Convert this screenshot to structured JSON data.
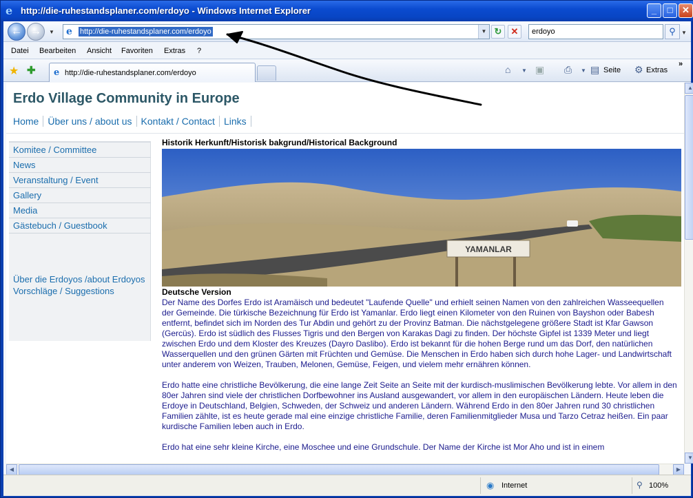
{
  "window": {
    "title": "http://die-ruhestandsplaner.com/erdoyo - Windows Internet Explorer",
    "buttons": {
      "minimize": "_",
      "maximize": "□",
      "close": "✕"
    }
  },
  "addressbar": {
    "back_icon": "back-arrow-icon",
    "forward_icon": "forward-arrow-icon",
    "url": "http://die-ruhestandsplaner.com/erdoyo",
    "search_value": "erdoyo"
  },
  "menubar": {
    "items": [
      "Datei",
      "Bearbeiten",
      "Ansicht",
      "Favoriten",
      "Extras",
      "?"
    ]
  },
  "tabbar": {
    "tab_label": "http://die-ruhestandsplaner.com/erdoyo",
    "commands": {
      "page": "Seite",
      "tools": "Extras"
    }
  },
  "page": {
    "site_title": "Erdo Village Community in Europe",
    "topnav": [
      "Home",
      "Über uns / about us",
      "Kontakt / Contact",
      "Links"
    ],
    "sidenav": [
      "Komitee / Committee",
      "News",
      "Veranstaltung / Event",
      "Gallery",
      "Media",
      "Gästebuch / Guestbook"
    ],
    "side_links": [
      "Über die Erdoyos /about Erdoyos",
      "Vorschläge / Suggestions"
    ],
    "section_heading": "Historik Herkunft/Historisk bakgrund/Historical Background",
    "photo_sign": "YAMANLAR",
    "version_heading": "Deutsche Version",
    "paragraphs": [
      "Der Name des Dorfes Erdo ist Aramäisch und bedeutet \"Laufende Quelle\" und erhielt seinen Namen von den zahlreichen Wasseequellen der Gemeinde. Die türkische Bezeichnung für Erdo ist Yamanlar. Erdo liegt einen Kilometer von den Ruinen von Bayshon oder Babesh entfernt, befindet sich im Norden des Tur Abdin und gehört zu der Provinz Batman. Die nächstgelegene größere Stadt ist Kfar Gawson (Gercüs). Erdo ist südlich des Flusses Tigris und den Bergen von Karakas Dagi zu finden. Der höchste Gipfel ist 1339 Meter und liegt zwischen Erdo und dem Kloster des Kreuzes (Dayro Daslibo). Erdo ist bekannt für die hohen Berge rund um das Dorf, den natürlichen Wasserquellen und den grünen Gärten mit Früchten und Gemüse. Die Menschen in Erdo haben sich durch hohe Lager- und Landwirtschaft unter anderem von Weizen, Trauben, Melonen, Gemüse, Feigen, und vielem mehr ernähren können.",
      "Erdo hatte eine christliche Bevölkerung, die eine lange Zeit Seite an Seite mit der kurdisch-muslimischen Bevölkerung lebte. Vor allem in den 80er Jahren sind viele der christlichen Dorfbewohner ins Ausland ausgewandert, vor allem in den europäischen Ländern. Heute leben die Erdoye in Deutschland, Belgien, Schweden, der Schweiz und anderen Ländern. Während Erdo in den 80er Jahren rund 30 christlichen Familien zählte, ist es heute gerade mal eine einzige christliche Familie, deren Familienmitglieder Musa und Tarzo Cetraz heißen. Ein paar kurdische Familien leben auch in Erdo.",
      "Erdo hat eine sehr kleine Kirche, eine Moschee und eine Grundschule. Der Name der Kirche ist Mor Aho und ist in einem"
    ]
  },
  "statusbar": {
    "zone": "Internet",
    "zoom": "100%"
  },
  "colors": {
    "title_bar": "#0b4bd0",
    "site_title": "#2c5766",
    "link": "#1a6dad",
    "body_text": "#1a1a8c"
  }
}
